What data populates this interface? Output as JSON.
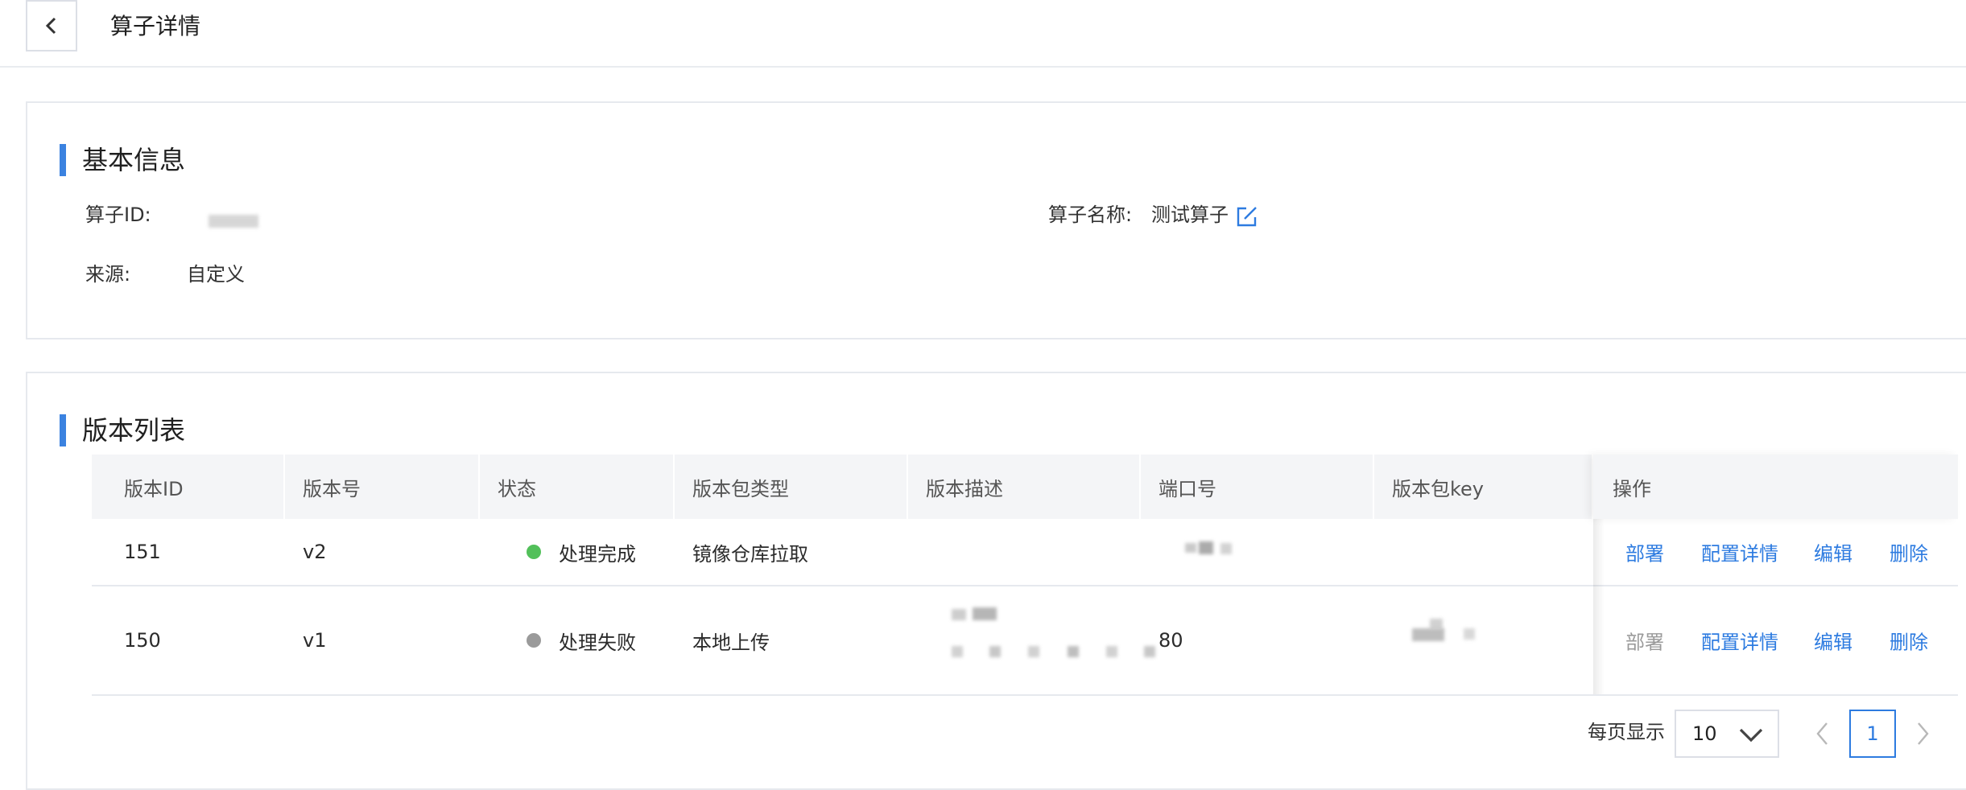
{
  "header": {
    "title": "算子详情"
  },
  "basic_info": {
    "section_title": "基本信息",
    "operator_id_label": "算子ID:",
    "operator_name_label": "算子名称:",
    "operator_name_value": "测试算子",
    "source_label": "来源:",
    "source_value": "自定义"
  },
  "versions": {
    "section_title": "版本列表",
    "columns": [
      "版本ID",
      "版本号",
      "状态",
      "版本包类型",
      "版本描述",
      "端口号",
      "版本包key",
      "操作"
    ],
    "rows": [
      {
        "id": "151",
        "version": "v2",
        "status": "处理完成",
        "status_color": "#52c05a",
        "package_type": "镜像仓库拉取",
        "port": "",
        "ops": {
          "deploy": "部署",
          "config": "配置详情",
          "edit": "编辑",
          "delete": "删除"
        },
        "deploy_enabled": true
      },
      {
        "id": "150",
        "version": "v1",
        "status": "处理失败",
        "status_color": "#9a9a9a",
        "package_type": "本地上传",
        "port": "80",
        "ops": {
          "deploy": "部署",
          "config": "配置详情",
          "edit": "编辑",
          "delete": "删除"
        },
        "deploy_enabled": false
      }
    ]
  },
  "pagination": {
    "per_page_label": "每页显示",
    "page_size": "10",
    "current_page": "1"
  },
  "colors": {
    "accent": "#3b82e0",
    "link": "#2d7be0",
    "success": "#52c05a",
    "failed": "#9a9a9a"
  },
  "icons": {
    "back": "chevron-left-icon",
    "edit": "external-edit-icon",
    "dropdown": "chevron-down-icon",
    "prev": "chevron-left-icon",
    "next": "chevron-right-icon"
  }
}
